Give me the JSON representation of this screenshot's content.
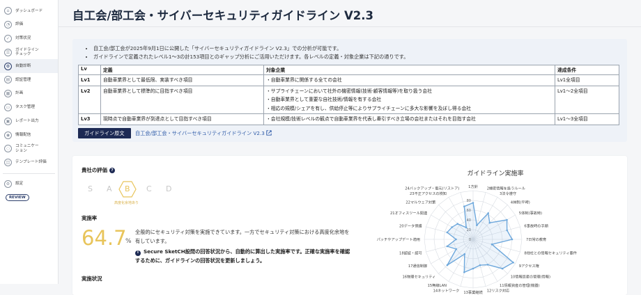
{
  "sidebar": {
    "items": [
      {
        "label": "ダッシュボード",
        "icon": "home-icon",
        "glyph": "⌂"
      },
      {
        "label": "評価",
        "icon": "evaluation-icon",
        "glyph": "◔"
      },
      {
        "label": "対策状況",
        "icon": "check-icon",
        "glyph": "✓"
      },
      {
        "label": "ガイドライン\nチェック",
        "icon": "checklist-icon",
        "glyph": "☰"
      },
      {
        "label": "自動診断",
        "icon": "gear-icon",
        "glyph": "⚙"
      },
      {
        "label": "認証管理",
        "icon": "certificate-icon",
        "glyph": "▤"
      },
      {
        "label": "計画",
        "icon": "calendar-icon",
        "glyph": "▦"
      },
      {
        "label": "タスク管理",
        "icon": "task-icon",
        "glyph": "▭"
      },
      {
        "label": "レポート出力",
        "icon": "report-icon",
        "glyph": "▣"
      },
      {
        "label": "情報配信",
        "icon": "broadcast-icon",
        "glyph": "◉"
      },
      {
        "label": "コミュニケー\nション",
        "icon": "chat-icon",
        "glyph": "◌"
      },
      {
        "label": "テンプレート評価",
        "icon": "template-icon",
        "glyph": "◫"
      }
    ],
    "settings_label": "設定",
    "review_label": "REVIEW"
  },
  "page": {
    "title": "自工会/部工会・サイバーセキュリティガイドライン V2.3"
  },
  "info": {
    "bullets": [
      "自工会/部工会が2025年9月1日に公開した「サイバーセキュリティガイドライン V2.3」での分析が可能です。",
      "ガイドラインで定義されたレベル1〜3の計153項目とのギャップ分析にご活用いただけます。各レベルの定義・対象企業は下記の通りです。"
    ],
    "table": {
      "headers": [
        "Lv",
        "定義",
        "対象企業",
        "達成条件"
      ],
      "rows": [
        {
          "lv": "Lv1",
          "definition": "自動車業界として最低限、実装すべき項目",
          "targets": [
            "・自動車業界に関係する全ての会社"
          ],
          "condition": "Lv1全項目"
        },
        {
          "lv": "Lv2",
          "definition": "自動車業界として標準的に目指すべき項目",
          "targets": [
            "・サプライチェーンにおいて社外の機密情報(技術·顧客情報等)を取り扱う会社",
            "・自動車業界として重要な自社技術/情報を有する会社",
            "・相応の規模/シェアを有し、供給停止等によりサプライチェーンに多大な影響を及ぼし得る会社"
          ],
          "condition": "Lv1〜2全項目"
        },
        {
          "lv": "Lv3",
          "definition": "現時点で自動車業界が到達点として目指すべき項目",
          "targets": [
            "・会社規模/技術レベルの観点で自動車業界を代表し牽引すべき立場の会社またはそれを目指す会社"
          ],
          "condition": "Lv1〜3全項目"
        }
      ]
    },
    "button_label": "ガイドライン原文",
    "link_label": "自工会/部工会・サイバーセキュリティガイドライン V2.3"
  },
  "evaluation": {
    "title": "貴社の評価",
    "grades": [
      "S",
      "A",
      "B",
      "C",
      "D"
    ],
    "current_grade": "B",
    "grade_caption": "高度化余地あり",
    "rate_title": "実施率",
    "rate_value": "64.7",
    "rate_unit": "%",
    "rate_desc": "全般的にセキュリティ対策を実施できています。一方でセキュリティ対策における高度化余地を有しています。",
    "rate_note": "Secure SketCH設問の回答状況から、自動的に算出した実施率です。正確な実施率を確認するために、ガイドラインの回答状況を更新しましょう。",
    "status_title": "実施状況",
    "accent_color": "#e8c45a"
  },
  "chart_data": {
    "type": "radar",
    "title": "ガイドライン実施率",
    "categories": [
      "1方針",
      "2機密情報を扱うルール",
      "3法令遵守",
      "4体制(平時)",
      "5体制(事故時)",
      "6事故時の手順",
      "7日常の教育",
      "8他社との情報セキュリティ要件",
      "9アクセス権",
      "10情報資産の管理(情報)",
      "11情報資産の管理(機器)",
      "12リスク対応",
      "13事業継続",
      "14ネットワーク",
      "15無線LAN",
      "16物理セキュリティ",
      "17通信制御",
      "18認証・認可",
      "19パッチやアップデート適用",
      "20データ保護",
      "21オフィスツール関連",
      "22マルウェア対策",
      "23不正アクセスの検知",
      "24バックアップ・復元(リストア)"
    ],
    "values": [
      75,
      30,
      62,
      48,
      80,
      72,
      80,
      40,
      95,
      85,
      60,
      55,
      60,
      70,
      35,
      75,
      40,
      55,
      35,
      55,
      50,
      45,
      28,
      70
    ],
    "rlim": [
      0,
      100
    ],
    "ticks": [
      0,
      20,
      40,
      60,
      80
    ],
    "color": "#6ea8dc"
  }
}
